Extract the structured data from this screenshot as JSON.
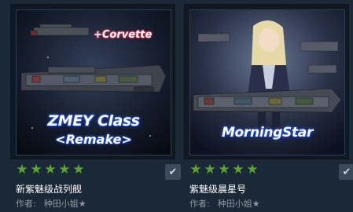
{
  "items": [
    {
      "overlay_top": "+Corvette",
      "overlay_main": "ZMEY Class",
      "overlay_sub": "<Remake>",
      "name": "新紫魅级战列舰",
      "author_label": "作者:",
      "author_name": "种田小姐★",
      "rating_stars": 5
    },
    {
      "overlay_main": "MorningStar",
      "name": "紫魅级晨星号",
      "author_label": "作者:",
      "author_name": "种田小姐★",
      "rating_stars": 5
    }
  ],
  "icons": {
    "star": "★",
    "check": "✔"
  },
  "colors": {
    "background": "#1b2838",
    "star": "#5ba32b",
    "text": "#ffffff",
    "muted": "#8f98a0"
  }
}
